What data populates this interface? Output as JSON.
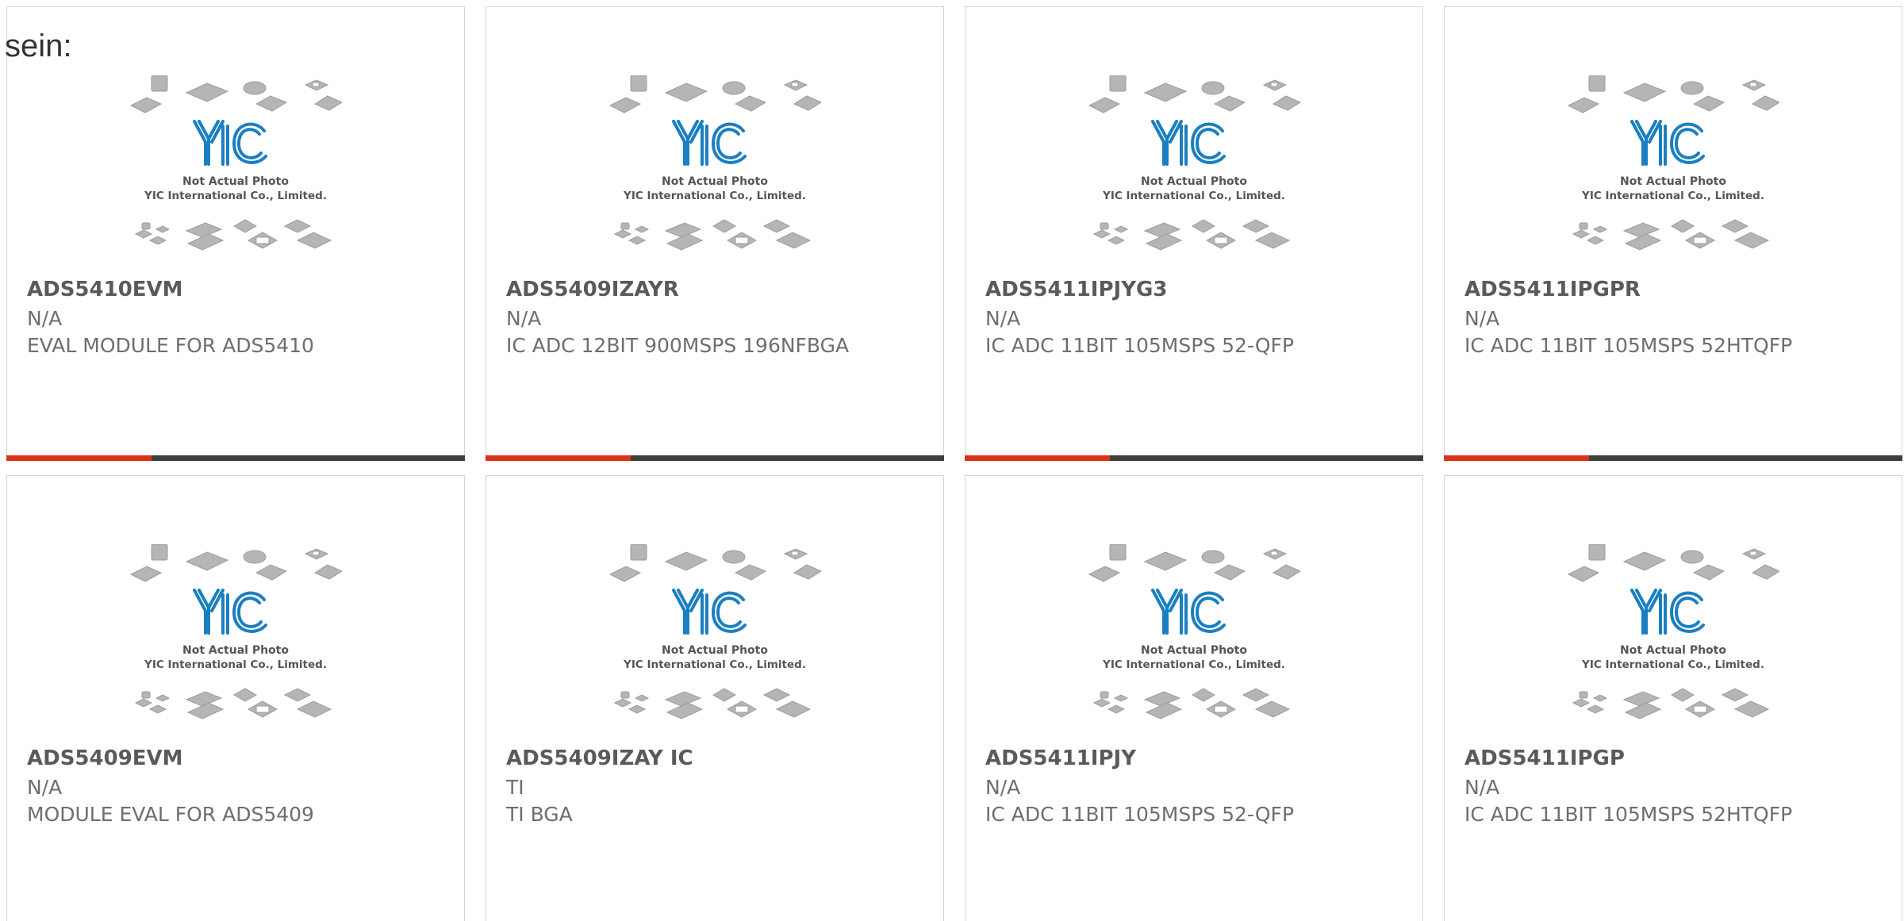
{
  "intro_text": "sein:",
  "colors": {
    "accent": "#d9341a",
    "bar": "#3d3d3d",
    "logo": "#1a7fc1",
    "chip": "#a9a9a9"
  },
  "photo": {
    "caption_line1": "Not Actual Photo",
    "caption_line2": "YIC International Co., Limited.",
    "logo_text": "YIC"
  },
  "products": [
    {
      "part": "ADS5410EVM",
      "manufacturer": "N/A",
      "description": "EVAL MODULE FOR ADS5410"
    },
    {
      "part": "ADS5409IZAYR",
      "manufacturer": "N/A",
      "description": "IC ADC 12BIT 900MSPS 196NFBGA"
    },
    {
      "part": "ADS5411IPJYG3",
      "manufacturer": "N/A",
      "description": "IC ADC 11BIT 105MSPS 52-QFP"
    },
    {
      "part": "ADS5411IPGPR",
      "manufacturer": "N/A",
      "description": "IC ADC 11BIT 105MSPS 52HTQFP"
    },
    {
      "part": "ADS5409EVM",
      "manufacturer": "N/A",
      "description": "MODULE EVAL FOR ADS5409"
    },
    {
      "part": "ADS5409IZAY IC",
      "manufacturer": "TI",
      "description": "TI BGA"
    },
    {
      "part": "ADS5411IPJY",
      "manufacturer": "N/A",
      "description": "IC ADC 11BIT 105MSPS 52-QFP"
    },
    {
      "part": "ADS5411IPGP",
      "manufacturer": "N/A",
      "description": "IC ADC 11BIT 105MSPS 52HTQFP"
    }
  ]
}
